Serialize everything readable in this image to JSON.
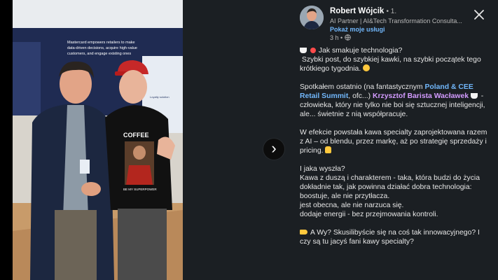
{
  "author": {
    "name": "Robert Wójcik",
    "degree": "• 1.",
    "headline": "AI Partner | AI&Tech Transformation Consulta...",
    "services_link": "Pokaż moje usługi",
    "time": "3 h •"
  },
  "photo_banner": {
    "line1": "Mastercard empowers retailers to make",
    "line2": "data-driven decisions, acquire high-value",
    "line3": "customers, and engage existing ones",
    "side_label": "Loyalty solution",
    "shirt_text": "COFFEE",
    "shirt_small": "BE MY SUPERPOWER"
  },
  "post": {
    "p1_line1": "Jak smakuje technologia?",
    "p1_line2": "Szybki post, do szybkiej kawki, na szybki początek tego krótkiego tygodnia.",
    "p2_a": "Spotkałem ostatnio (na fantastycznym ",
    "p2_link": "Poland & CEE Retail Summit",
    "p2_b": ", ofc...) ",
    "p2_mention": "Krzysztof Barista Wacławek",
    "p2_c": " - człowieka, który nie tylko nie boi się sztucznej inteligencji, ale... świetnie z nią współpracuje.",
    "p3": "W efekcie powstała kawa specialty zaprojektowana razem z AI – od blendu, przez markę, aż po strategię sprzedaży i pricing.",
    "p4_line1": "I jaka wyszła?",
    "p4_line2": "Kawa z duszą i charakterem - taka, która budzi do życia dokładnie tak, jak powinna działać dobra technologia:",
    "p4_line3": "boostuje, ale nie przytłacza.",
    "p4_line4": "jest obecna, ale nie narzuca się.",
    "p4_line5": "dodaje energii - bez przejmowania kontroli.",
    "p5": "A Wy? Skusilibyście się na coś tak innowacyjnego? I czy są tu jacyś fani kawy specialty?"
  },
  "icons": {
    "close": "close-icon",
    "next": "chevron-right-icon",
    "globe": "globe-icon"
  },
  "colors": {
    "panel": "#1b1f23",
    "link": "#71b7fb",
    "mention": "#d39bff"
  }
}
